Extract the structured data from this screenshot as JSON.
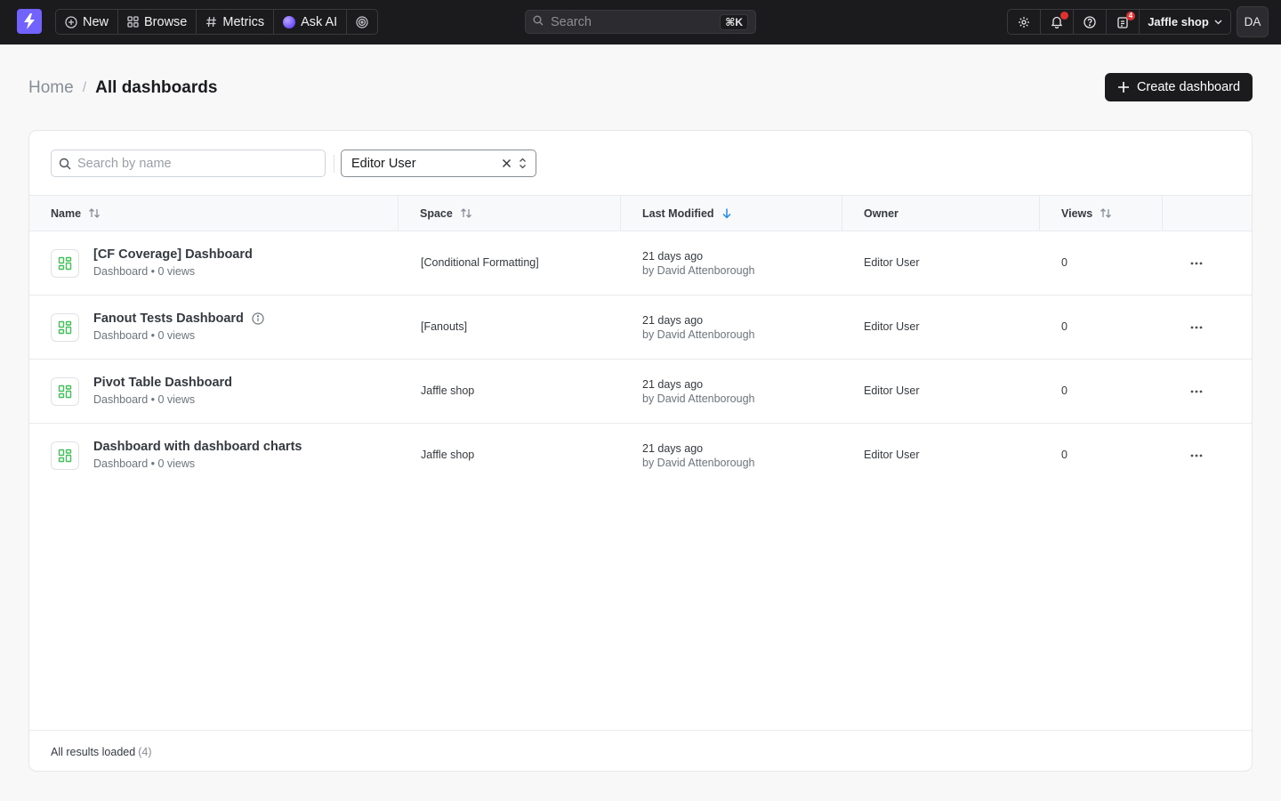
{
  "nav": {
    "new_label": "New",
    "browse_label": "Browse",
    "metrics_label": "Metrics",
    "ask_ai_label": "Ask AI"
  },
  "search": {
    "placeholder": "Search",
    "shortcut": "⌘K"
  },
  "header_right": {
    "notifications_badge": "",
    "tasks_badge": "4",
    "project_name": "Jaffle shop",
    "avatar_initials": "DA"
  },
  "breadcrumb": {
    "home": "Home",
    "separator": "/",
    "current": "All dashboards"
  },
  "create_button_label": "Create dashboard",
  "filters": {
    "name_placeholder": "Search by name",
    "owner_value": "Editor User"
  },
  "table": {
    "columns": {
      "name": "Name",
      "space": "Space",
      "last_modified": "Last Modified",
      "owner": "Owner",
      "views": "Views"
    },
    "rows": [
      {
        "name": "[CF Coverage] Dashboard",
        "subtitle": "Dashboard • 0 views",
        "space": "[Conditional Formatting]",
        "modified": "21 days ago",
        "modified_by": "by David Attenborough",
        "owner": "Editor User",
        "views": "0"
      },
      {
        "name": "Fanout Tests Dashboard",
        "subtitle": "Dashboard • 0 views",
        "space": "[Fanouts]",
        "modified": "21 days ago",
        "modified_by": "by David Attenborough",
        "owner": "Editor User",
        "views": "0"
      },
      {
        "name": "Pivot Table Dashboard",
        "subtitle": "Dashboard • 0 views",
        "space": "Jaffle shop",
        "modified": "21 days ago",
        "modified_by": "by David Attenborough",
        "owner": "Editor User",
        "views": "0"
      },
      {
        "name": "Dashboard with dashboard charts",
        "subtitle": "Dashboard • 0 views",
        "space": "Jaffle shop",
        "modified": "21 days ago",
        "modified_by": "by David Attenborough",
        "owner": "Editor User",
        "views": "0"
      }
    ]
  },
  "footer": {
    "status": "All results loaded",
    "count": "(4)"
  },
  "colors": {
    "brand": "#7262ff",
    "topbar": "#1b1b1d",
    "dashboard_icon": "#40c057",
    "sort_active": "#228be6",
    "alert": "#e03131"
  }
}
